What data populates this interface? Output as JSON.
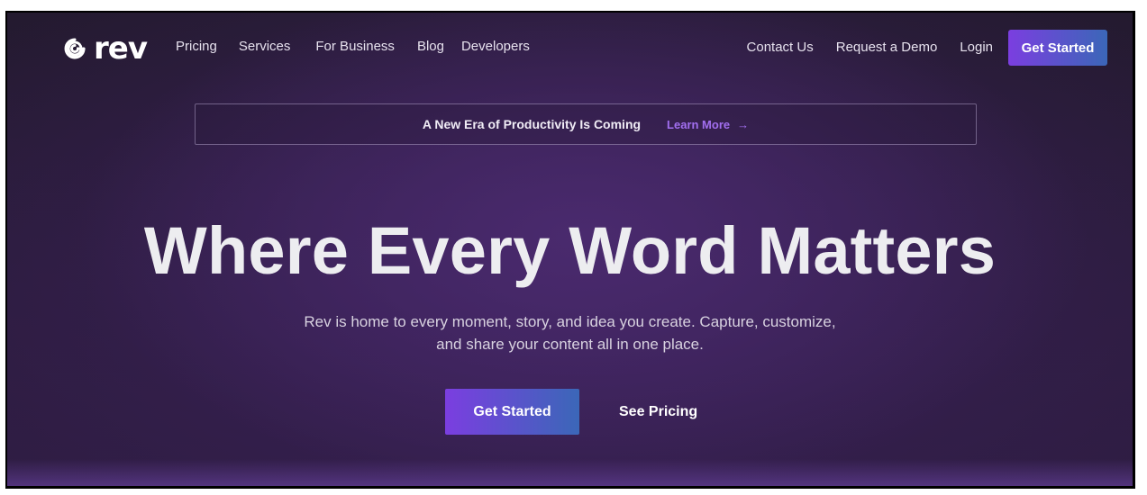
{
  "brand": {
    "name": "rev",
    "logo_icon": "rev-swirl-icon"
  },
  "nav": {
    "left_links": [
      "Pricing",
      "Services",
      "For Business",
      "Blog",
      "Developers"
    ],
    "contact": "Contact Us",
    "demo": "Request a Demo",
    "login": "Login",
    "cta": "Get Started"
  },
  "announcement": {
    "text": "A New Era of Productivity Is Coming",
    "link": "Learn More",
    "link_icon": "arrow-right-icon"
  },
  "hero": {
    "title": "Where Every Word Matters",
    "subtitle_line1": "Rev is home to every moment, story, and idea you create. Capture, customize,",
    "subtitle_line2": "and share your content all in one place.",
    "primary_cta": "Get Started",
    "secondary_cta": "See Pricing"
  },
  "colors": {
    "accent_purple": "#7b3ee0",
    "accent_blue": "#3b67b8",
    "link_purple": "#a26ff0",
    "background": "#2a1b3a"
  }
}
